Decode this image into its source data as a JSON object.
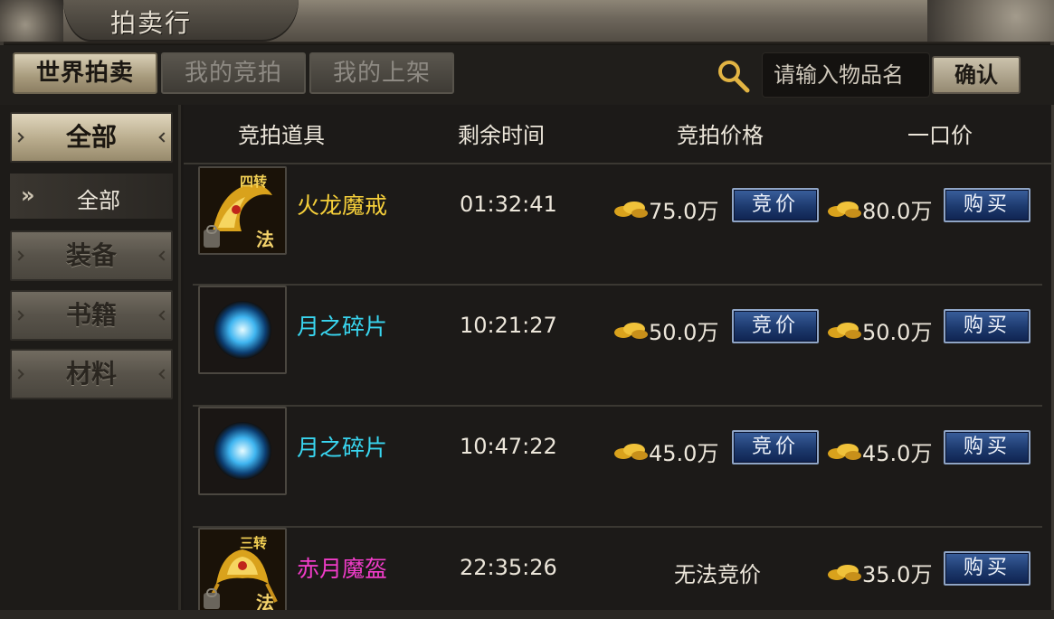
{
  "window": {
    "title": "拍卖行"
  },
  "tabs": [
    {
      "label": "世界拍卖",
      "active": true
    },
    {
      "label": "我的竞拍",
      "active": false
    },
    {
      "label": "我的上架",
      "active": false
    }
  ],
  "search": {
    "icon": "search-icon",
    "placeholder": "请输入物品名",
    "confirm_label": "确认"
  },
  "sidebar": {
    "categories": [
      {
        "label": "全部",
        "active": true
      },
      {
        "label": "装备",
        "active": false
      },
      {
        "label": "书籍",
        "active": false
      },
      {
        "label": "材料",
        "active": false
      }
    ],
    "sub_item": {
      "chevron": "»",
      "label": "全部"
    }
  },
  "table": {
    "headers": [
      "竞拍道具",
      "剩余时间",
      "竞拍价格",
      "一口价"
    ],
    "bid_button_label": "竞价",
    "buy_button_label": "购买",
    "rows": [
      {
        "name": "火龙魔戒",
        "name_color": "#f5cf3a",
        "icon": "dragon-ring-icon",
        "badge": "四转",
        "badge2": "法",
        "time": "01:32:41",
        "bid_price": "75.0万",
        "can_bid": true,
        "buy_price": "80.0万"
      },
      {
        "name": "月之碎片",
        "name_color": "#39d6f0",
        "icon": "moon-shard-icon",
        "time": "10:21:27",
        "bid_price": "50.0万",
        "can_bid": true,
        "buy_price": "50.0万"
      },
      {
        "name": "月之碎片",
        "name_color": "#39d6f0",
        "icon": "moon-shard-icon",
        "time": "10:47:22",
        "bid_price": "45.0万",
        "can_bid": true,
        "buy_price": "45.0万"
      },
      {
        "name": "赤月魔盔",
        "name_color": "#f03cc8",
        "icon": "red-moon-helmet-icon",
        "badge": "三转",
        "badge2": "法",
        "time": "22:35:26",
        "bid_price": "",
        "no_bid_text": "无法竞价",
        "can_bid": false,
        "buy_price": "35.0万"
      }
    ]
  },
  "colors": {
    "accent_gold": "#e7b42a",
    "button_blue": "#1d3a6e",
    "frame_stone": "#6e675c"
  }
}
